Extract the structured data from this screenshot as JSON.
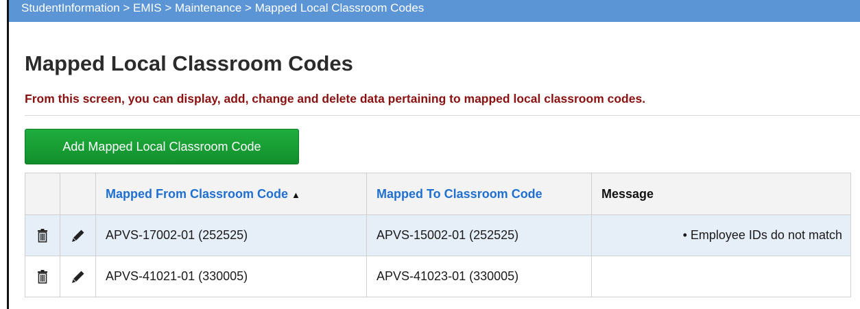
{
  "breadcrumb": {
    "items": [
      "StudentInformation",
      "EMIS",
      "Maintenance",
      "Mapped Local Classroom Codes"
    ],
    "separator": " > "
  },
  "page": {
    "title": "Mapped Local Classroom Codes",
    "description": "From this screen, you can display, add, change and delete data pertaining to mapped local classroom codes."
  },
  "toolbar": {
    "add_label": "Add Mapped Local Classroom Code"
  },
  "table": {
    "columns": {
      "from": "Mapped From Classroom Code",
      "sort_indicator": "▲",
      "to": "Mapped To Classroom Code",
      "message": "Message"
    },
    "rows": [
      {
        "from": "APVS-17002-01 (252525)",
        "to": "APVS-15002-01 (252525)",
        "message": "• Employee IDs do not match"
      },
      {
        "from": "APVS-41021-01 (330005)",
        "to": "APVS-41023-01 (330005)",
        "message": ""
      }
    ]
  },
  "icons": {
    "row_delete": "trash-icon",
    "row_edit": "pencil-icon"
  },
  "colors": {
    "breadcrumb_bg": "#5b95d6",
    "button_bg": "#1fae3d",
    "description_text": "#8b1010",
    "link_header": "#1f6fd1",
    "row_alt_bg": "#e6eef7"
  }
}
